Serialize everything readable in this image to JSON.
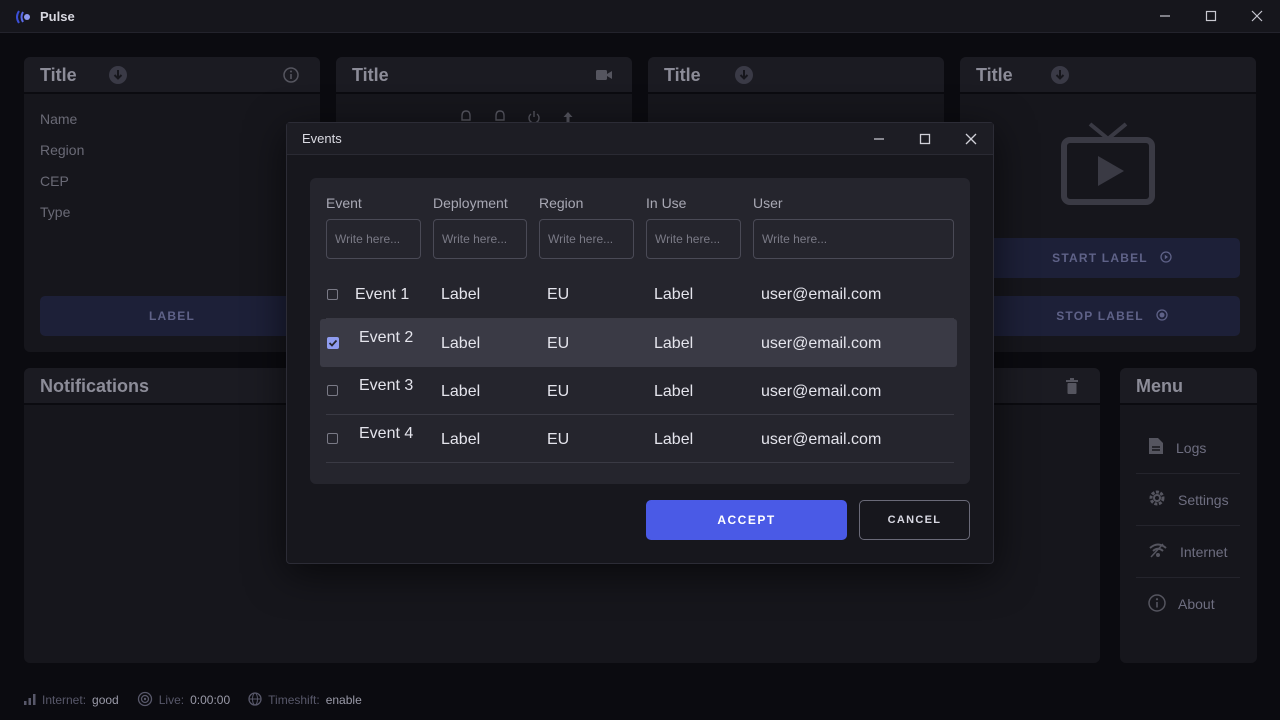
{
  "app": {
    "title": "Pulse"
  },
  "cards": [
    {
      "title": "Title",
      "fields": [
        "Name",
        "Region",
        "CEP",
        "Type"
      ],
      "button_label": "LABEL"
    },
    {
      "title": "Title"
    },
    {
      "title": "Title"
    },
    {
      "title": "Title",
      "start_label": "START LABEL",
      "stop_label": "STOP LABEL"
    }
  ],
  "notifications": {
    "title": "Notifications"
  },
  "menu": {
    "title": "Menu",
    "items": [
      {
        "label": "Logs",
        "icon": "document-icon"
      },
      {
        "label": "Settings",
        "icon": "gear-icon"
      },
      {
        "label": "Internet",
        "icon": "wifi-icon"
      },
      {
        "label": "About",
        "icon": "info-icon"
      }
    ]
  },
  "status_bar": {
    "internet_label": "Internet:",
    "internet_value": "good",
    "live_label": "Live:",
    "live_value": "0:00:00",
    "timeshift_label": "Timeshift:",
    "timeshift_value": "enable"
  },
  "dialog": {
    "title": "Events",
    "columns": [
      "Event",
      "Deployment",
      "Region",
      "In Use",
      "User"
    ],
    "filter_placeholder": "Write here...",
    "rows": [
      {
        "event": "Event 1",
        "deployment": "Label",
        "region": "EU",
        "in_use": "Label",
        "user": "user@email.com",
        "selected": false
      },
      {
        "event": "Event 2",
        "deployment": "Label",
        "region": "EU",
        "in_use": "Label",
        "user": "user@email.com",
        "selected": true
      },
      {
        "event": "Event 3",
        "deployment": "Label",
        "region": "EU",
        "in_use": "Label",
        "user": "user@email.com",
        "selected": false
      },
      {
        "event": "Event 4",
        "deployment": "Label",
        "region": "EU",
        "in_use": "Label",
        "user": "user@email.com",
        "selected": false
      }
    ],
    "accept_label": "ACCEPT",
    "cancel_label": "CANCEL"
  },
  "colors": {
    "accent": "#4a5ae6",
    "checkbox_checked": "#8f9cf0",
    "background": "#0b0b10",
    "card": "#16161c"
  }
}
